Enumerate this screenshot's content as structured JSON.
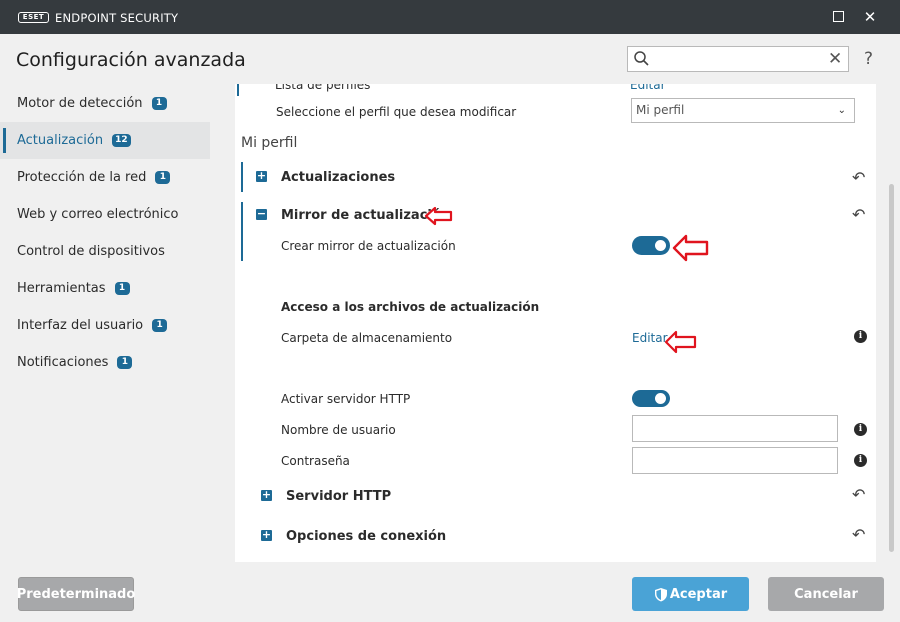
{
  "app": {
    "logo": "eset",
    "title": "ENDPOINT SECURITY"
  },
  "page": {
    "title": "Configuración avanzada"
  },
  "search": {
    "value": "",
    "placeholder": ""
  },
  "sidebar": {
    "items": [
      {
        "label": "Motor de detección",
        "badge": "1"
      },
      {
        "label": "Actualización",
        "badge": "12",
        "active": true
      },
      {
        "label": "Protección de la red",
        "badge": "1"
      },
      {
        "label": "Web y correo electrónico",
        "badge": ""
      },
      {
        "label": "Control de dispositivos",
        "badge": ""
      },
      {
        "label": "Herramientas",
        "badge": "1"
      },
      {
        "label": "Interfaz del usuario",
        "badge": "1"
      },
      {
        "label": "Notificaciones",
        "badge": "1"
      }
    ]
  },
  "main": {
    "cut_row": {
      "label": "Lista de perfiles",
      "link": "Editar"
    },
    "profile_select": {
      "label": "Seleccione el perfil que desea modificar",
      "value": "Mi perfil"
    },
    "profile_heading": "Mi perfil",
    "section_updates": "Actualizaciones",
    "section_mirror": "Mirror de actualización",
    "create_mirror": {
      "label": "Crear mirror de actualización",
      "enabled": true
    },
    "access_heading": "Acceso a los archivos de actualización",
    "storage_folder": {
      "label": "Carpeta de almacenamiento",
      "link": "Editar"
    },
    "http_server_toggle": {
      "label": "Activar servidor HTTP",
      "enabled": true
    },
    "username": {
      "label": "Nombre de usuario",
      "value": ""
    },
    "password": {
      "label": "Contraseña",
      "value": ""
    },
    "section_http_server": "Servidor HTTP",
    "section_connection": "Opciones de conexión"
  },
  "footer": {
    "default_label": "Predeterminado",
    "accept_label": "Aceptar",
    "cancel_label": "Cancelar"
  },
  "colors": {
    "accent": "#1d6a96",
    "titlebar": "#353a3e",
    "annotation_arrow": "#e0141e",
    "accept": "#4aa3d6",
    "neutral_button": "#a7a8aa"
  }
}
